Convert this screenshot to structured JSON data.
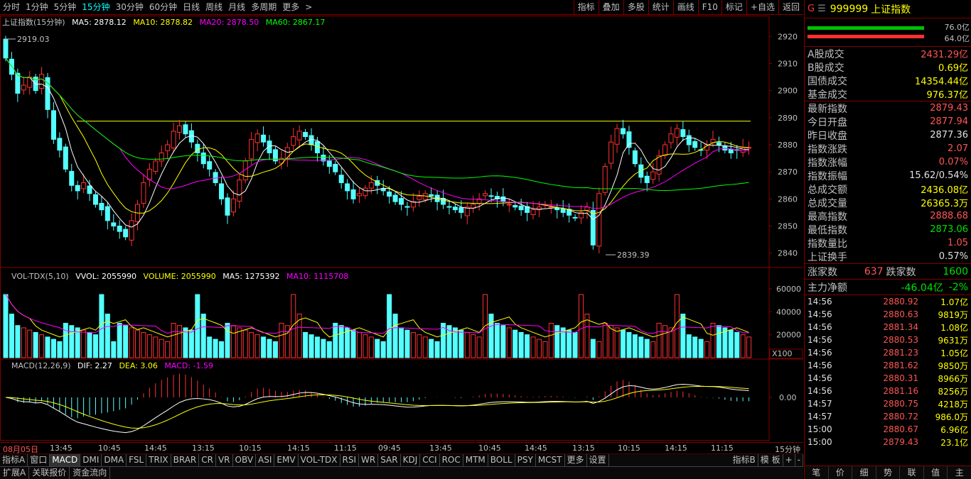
{
  "toolbar": {
    "periods": [
      "分时",
      "1分钟",
      "5分钟",
      "15分钟",
      "30分钟",
      "60分钟",
      "日线",
      "周线",
      "月线",
      "多周期",
      "更多"
    ],
    "active_period": "15分钟",
    "more_arrow": ">",
    "right": [
      "指标",
      "叠加",
      "多股",
      "统计",
      "画线",
      "F10",
      "标记",
      "+自选",
      "返回"
    ]
  },
  "chart": {
    "main_title": "上证指数(15分钟)",
    "ma5": "MA5: 2878.12",
    "ma10": "MA10: 2878.82",
    "ma20": "MA20: 2878.50",
    "ma60": "MA60: 2867.17",
    "high_label": "2919.03",
    "low_label": "2839.39",
    "price_ticks": [
      "2920",
      "2910",
      "2900",
      "2890",
      "2880",
      "2870",
      "2860",
      "2850",
      "2840"
    ],
    "vol_title": "VOL-TDX(5,10)",
    "vol_vvol": "VVOL: 2055990",
    "vol_volume": "VOLUME: 2055990",
    "vol_ma5": "MA5: 1275392",
    "vol_ma10": "MA10: 1115708",
    "vol_ticks": [
      "60000",
      "40000",
      "20000"
    ],
    "vol_unit": "X100",
    "macd_title": "MACD(12,26,9)",
    "macd_dif": "DIF: 2.27",
    "macd_dea": "DEA: 3.06",
    "macd_val": "MACD: -1.59",
    "macd_tick": "0.00",
    "time_labels": [
      "08月05日",
      "13:45",
      "10:45",
      "14:45",
      "13:15",
      "10:15",
      "14:15",
      "11:15",
      "09:45",
      "13:45",
      "10:45",
      "14:45",
      "13:15",
      "10:15",
      "14:15",
      "11:15"
    ],
    "period_label": "15分钟"
  },
  "chart_data": {
    "type": "candlestick",
    "title": "上证指数(15分钟)",
    "ylim": [
      2836,
      2924
    ],
    "high": 2919.03,
    "low": 2839.39,
    "close": [
      2912,
      2906,
      2899,
      2902,
      2905,
      2900,
      2906,
      2893,
      2882,
      2878,
      2871,
      2865,
      2863,
      2866,
      2862,
      2858,
      2856,
      2852,
      2850,
      2848,
      2846,
      2852,
      2858,
      2866,
      2871,
      2874,
      2877,
      2880,
      2885,
      2887,
      2884,
      2881,
      2877,
      2873,
      2871,
      2866,
      2860,
      2854,
      2860,
      2867,
      2874,
      2882,
      2884,
      2881,
      2877,
      2874,
      2875,
      2879,
      2883,
      2885,
      2883,
      2880,
      2877,
      2874,
      2872,
      2870,
      2866,
      2863,
      2860,
      2862,
      2864,
      2866,
      2865,
      2863,
      2861,
      2859,
      2858,
      2857,
      2859,
      2861,
      2862,
      2861,
      2859,
      2858,
      2857,
      2856,
      2855,
      2857,
      2858,
      2860,
      2862,
      2861,
      2860,
      2859,
      2858,
      2857,
      2856,
      2855,
      2856,
      2857,
      2858,
      2857,
      2856,
      2855,
      2854,
      2853,
      2855,
      2857,
      2843,
      2862,
      2872,
      2881,
      2886,
      2884,
      2879,
      2873,
      2868,
      2866,
      2870,
      2876,
      2880,
      2884,
      2886,
      2883,
      2880,
      2879,
      2878,
      2880,
      2882,
      2880,
      2878,
      2877,
      2878,
      2879,
      2879
    ]
  },
  "panel": {
    "g": "G",
    "menu": "☰",
    "code": "999999",
    "name": "上证指数",
    "bar1_label": "76.0亿",
    "bar2_label": "64.0亿",
    "rows1": [
      [
        "A股成交",
        "2431.29亿",
        "red"
      ],
      [
        "B股成交",
        "0.69亿",
        "yellow"
      ],
      [
        "国债成交",
        "14354.44亿",
        "yellow"
      ],
      [
        "基金成交",
        "976.37亿",
        "yellow"
      ]
    ],
    "rows2": [
      [
        "最新指数",
        "2879.43",
        "red"
      ],
      [
        "今日开盘",
        "2877.94",
        "red"
      ],
      [
        "昨日收盘",
        "2877.36",
        "white"
      ],
      [
        "指数涨跌",
        "2.07",
        "red"
      ],
      [
        "指数涨幅",
        "0.07%",
        "red"
      ],
      [
        "指数振幅",
        "15.62/0.54%",
        "white"
      ],
      [
        "总成交额",
        "2436.08亿",
        "yellow"
      ],
      [
        "总成交量",
        "26365.3万",
        "yellow"
      ],
      [
        "最高指数",
        "2888.68",
        "red"
      ],
      [
        "最低指数",
        "2873.06",
        "green"
      ],
      [
        "指数量比",
        "1.05",
        "red"
      ],
      [
        "上证换手",
        "0.57%",
        "white"
      ]
    ],
    "up_label": "涨家数",
    "up": "637",
    "down_label": "跌家数",
    "down": "1600",
    "main_label": "主力净额",
    "main_val": "-46.04亿",
    "main_pct": "-2%",
    "ticks": [
      [
        "14:56",
        "2880.92",
        "1.07亿"
      ],
      [
        "14:56",
        "2880.63",
        "9819万"
      ],
      [
        "14:56",
        "2881.34",
        "1.08亿"
      ],
      [
        "14:56",
        "2880.53",
        "9631万"
      ],
      [
        "14:56",
        "2881.23",
        "1.05亿"
      ],
      [
        "14:56",
        "2881.62",
        "9850万"
      ],
      [
        "14:56",
        "2880.31",
        "8966万"
      ],
      [
        "14:56",
        "2881.16",
        "8256万"
      ],
      [
        "14:57",
        "2880.75",
        "4218万"
      ],
      [
        "14:57",
        "2880.72",
        "986.0万"
      ],
      [
        "15:00",
        "2880.67",
        "6.96亿"
      ],
      [
        "15:00",
        "2879.43",
        "23.1亿"
      ]
    ],
    "foot": [
      "笔",
      "价",
      "细",
      "势",
      "联",
      "值",
      "主"
    ]
  },
  "tabs1": [
    "指标A",
    "窗口",
    "MACD",
    "DMI",
    "DMA",
    "FSL",
    "TRIX",
    "BRAR",
    "CR",
    "VR",
    "OBV",
    "ASI",
    "EMV",
    "VOL-TDX",
    "RSI",
    "WR",
    "SAR",
    "KDJ",
    "CCI",
    "ROC",
    "MTM",
    "BOLL",
    "PSY",
    "MCST",
    "更多",
    "设置"
  ],
  "tabs1_right": [
    "指标B",
    "模 板",
    "+",
    "-"
  ],
  "tabs2": [
    "扩展A",
    "关联报价",
    "资金流向"
  ],
  "colors": {
    "up": "#ff3232",
    "down": "#54ffff",
    "ma5": "#ffffff",
    "ma10": "#ffff00",
    "ma20": "#ff00ff",
    "ma60": "#00ff00",
    "frame": "#800000"
  }
}
